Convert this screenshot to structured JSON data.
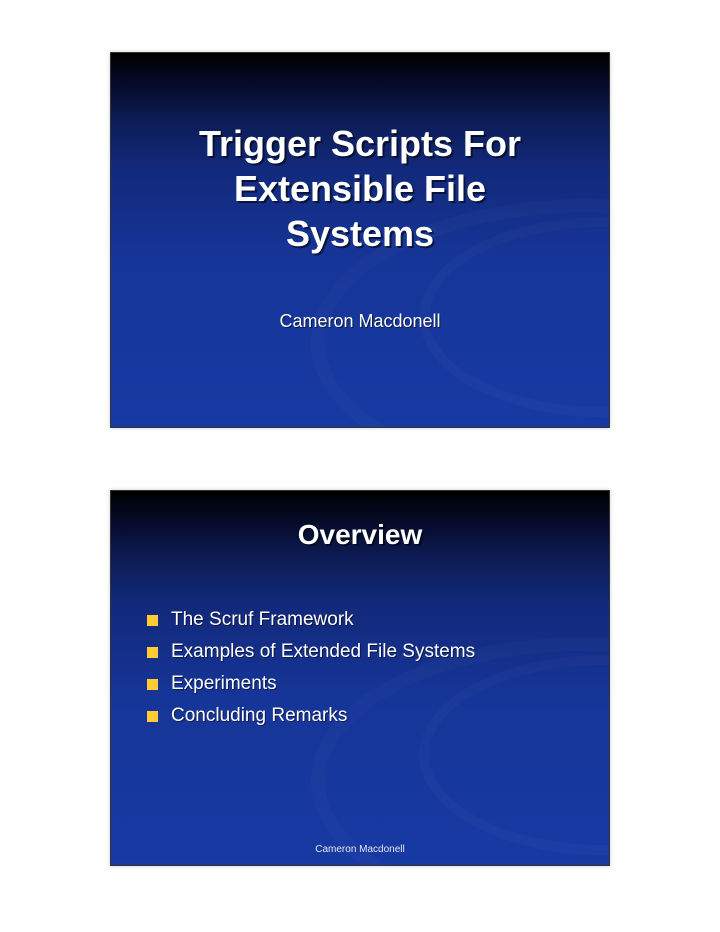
{
  "slide1": {
    "title_line1": "Trigger Scripts For",
    "title_line2": "Extensible File",
    "title_line3": "Systems",
    "author": "Cameron Macdonell"
  },
  "slide2": {
    "heading": "Overview",
    "bullets": [
      "The Scruf Framework",
      "Examples of Extended File Systems",
      "Experiments",
      "Concluding Remarks"
    ],
    "footer": "Cameron Macdonell"
  },
  "colors": {
    "bullet": "#ffcc33",
    "bg_top": "#000000",
    "bg_bottom": "#173aa3"
  }
}
